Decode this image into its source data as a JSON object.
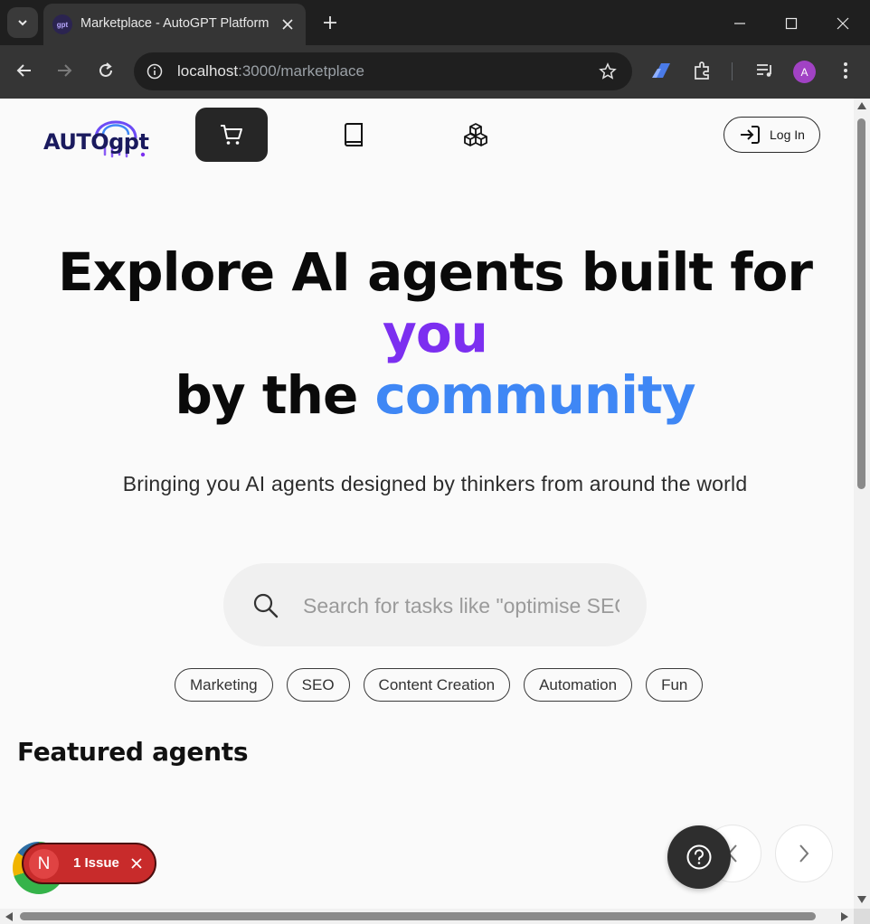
{
  "browser": {
    "tab_title": "Marketplace - AutoGPT Platform",
    "favicon_text": "gpt",
    "url_host": "localhost",
    "url_path": ":3000/marketplace",
    "profile_initial": "A"
  },
  "site": {
    "logo_text": "AUTOgpt",
    "nav": [
      {
        "name": "marketplace",
        "icon": "cart-icon",
        "active": true
      },
      {
        "name": "library",
        "icon": "book-icon",
        "active": false
      },
      {
        "name": "build",
        "icon": "cubes-icon",
        "active": false
      }
    ],
    "login_label": "Log In"
  },
  "hero": {
    "line1": "Explore AI agents built for",
    "line2": "you",
    "line3_prefix": "by the",
    "line3_accent": "community",
    "subtitle": "Bringing you AI agents designed by thinkers from around the world",
    "accent_purple": "#7c2ff0",
    "accent_blue": "#3f87f5"
  },
  "search": {
    "placeholder": "Search for tasks like \"optimise SEO\""
  },
  "chips": [
    "Marketing",
    "SEO",
    "Content Creation",
    "Automation",
    "Fun"
  ],
  "featured": {
    "title": "Featured agents"
  },
  "dev_overlay": {
    "badge_letter": "N",
    "issues_label": "1 Issue"
  }
}
